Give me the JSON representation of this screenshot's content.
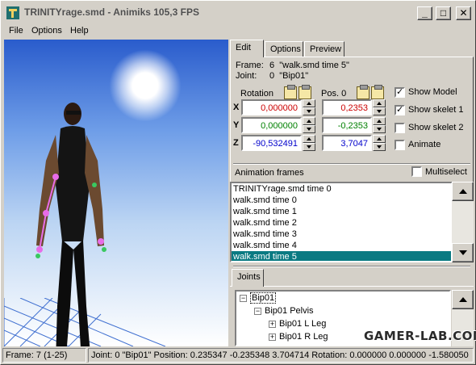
{
  "window": {
    "title": "TRINITYrage.smd - Animiks 105,3 FPS",
    "controls": {
      "minimize": "_",
      "maximize": "□",
      "close": "✕"
    }
  },
  "menu": {
    "file": "File",
    "options": "Options",
    "help": "Help"
  },
  "tabs": [
    "Edit",
    "Options",
    "Preview"
  ],
  "info": {
    "frame_label": "Frame:",
    "frame_value": "6",
    "frame_name": "\"walk.smd time 5\"",
    "joint_label": "Joint:",
    "joint_value": "0",
    "joint_name": "\"Bip01\""
  },
  "transform": {
    "rotation_label": "Rotation",
    "pos_label": "Pos. 0",
    "axes": [
      "X",
      "Y",
      "Z"
    ],
    "rotation": [
      "0,000000",
      "0,000000",
      "-90,532491"
    ],
    "position": [
      "0,2353",
      "-0,2353",
      "3,7047"
    ]
  },
  "checkboxes": [
    {
      "label": "Show Model",
      "checked": true
    },
    {
      "label": "Show skelet 1",
      "checked": true
    },
    {
      "label": "Show skelet 2",
      "checked": false
    },
    {
      "label": "Animate",
      "checked": false
    }
  ],
  "frames": {
    "header": "Animation frames",
    "multiselect": "Multiselect",
    "items": [
      "TRINITYrage.smd time 0",
      "walk.smd time 0",
      "walk.smd time 1",
      "walk.smd time 2",
      "walk.smd time 3",
      "walk.smd time 4",
      "walk.smd time 5"
    ],
    "selected_index": 6
  },
  "joints": {
    "tab": "Joints",
    "items": [
      "Bip01",
      "Bip01 Pelvis",
      "Bip01 L Leg",
      "Bip01 R Leg"
    ]
  },
  "status": {
    "frame": "Frame:   7 (1-25)",
    "joint": "Joint: 0 \"Bip01\" Position: 0.235347 -0.235348 3.704714 Rotation: 0.000000 0.000000 -1.580050"
  },
  "watermark": "GAMER-LAB.COM",
  "colors": {
    "rotation_x": "#cc0000",
    "rotation_y": "#008000",
    "rotation_z": "#0000cc",
    "selection": "#0a7a82"
  }
}
